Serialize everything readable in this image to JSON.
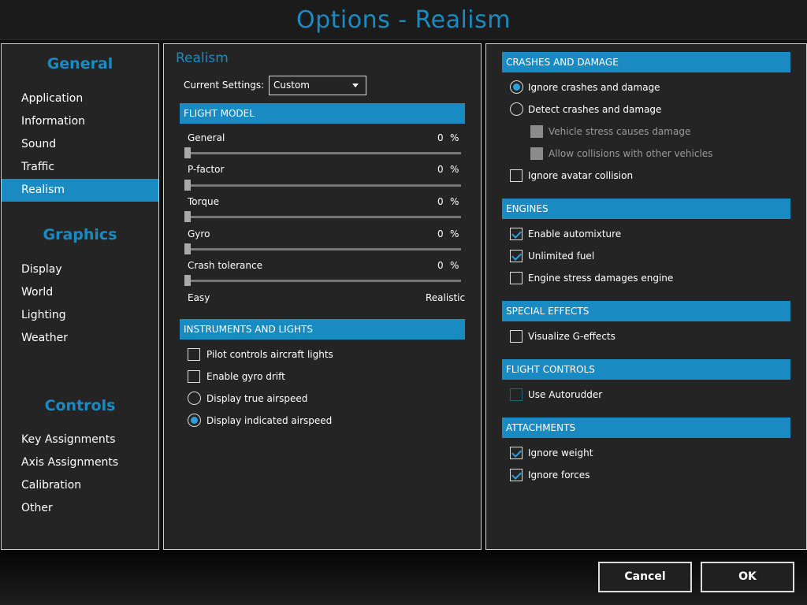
{
  "window": {
    "title": "Options - Realism"
  },
  "sidebar": {
    "groups": [
      {
        "heading": "General",
        "items": [
          "Application",
          "Information",
          "Sound",
          "Traffic",
          "Realism"
        ]
      },
      {
        "heading": "Graphics",
        "items": [
          "Display",
          "World",
          "Lighting",
          "Weather"
        ]
      },
      {
        "heading": "Controls",
        "items": [
          "Key Assignments",
          "Axis Assignments",
          "Calibration",
          "Other"
        ]
      }
    ],
    "selected_item": "Realism"
  },
  "realism": {
    "title": "Realism",
    "current_settings_label": "Current Settings:",
    "current_settings_value": "Custom",
    "flight_model": {
      "header": "FLIGHT MODEL",
      "sliders": [
        {
          "label": "General",
          "value": 0,
          "unit": "%"
        },
        {
          "label": "P-factor",
          "value": 0,
          "unit": "%"
        },
        {
          "label": "Torque",
          "value": 0,
          "unit": "%"
        },
        {
          "label": "Gyro",
          "value": 0,
          "unit": "%"
        },
        {
          "label": "Crash tolerance",
          "value": 0,
          "unit": "%"
        }
      ],
      "scale_min_label": "Easy",
      "scale_max_label": "Realistic"
    },
    "instruments": {
      "header": "INSTRUMENTS AND LIGHTS",
      "pilot_lights": {
        "label": "Pilot controls aircraft lights",
        "checked": false
      },
      "gyro_drift": {
        "label": "Enable gyro drift",
        "checked": false
      },
      "true_airspeed": {
        "label": "Display true airspeed",
        "selected": false
      },
      "indicated_airspeed": {
        "label": "Display indicated airspeed",
        "selected": true
      }
    }
  },
  "crashes": {
    "header": "CRASHES AND DAMAGE",
    "ignore": {
      "label": "Ignore crashes and damage",
      "selected": true
    },
    "detect": {
      "label": "Detect crashes and damage",
      "selected": false
    },
    "vehicle_stress": {
      "label": "Vehicle stress causes damage",
      "checked": false,
      "enabled": false
    },
    "allow_collisions": {
      "label": "Allow collisions with other vehicles",
      "checked": false,
      "enabled": false
    },
    "avatar_collision": {
      "label": "Ignore avatar collision",
      "checked": false
    }
  },
  "engines": {
    "header": "ENGINES",
    "automixture": {
      "label": "Enable automixture",
      "checked": true
    },
    "unlimited_fuel": {
      "label": "Unlimited fuel",
      "checked": true
    },
    "engine_stress": {
      "label": "Engine stress damages engine",
      "checked": false
    }
  },
  "special_effects": {
    "header": "SPECIAL EFFECTS",
    "g_effects": {
      "label": "Visualize G-effects",
      "checked": false
    }
  },
  "flight_controls": {
    "header": "FLIGHT CONTROLS",
    "autorudder": {
      "label": "Use Autorudder",
      "checked": false
    }
  },
  "attachments": {
    "header": "ATTACHMENTS",
    "ignore_weight": {
      "label": "Ignore weight",
      "checked": true
    },
    "ignore_forces": {
      "label": "Ignore forces",
      "checked": true
    }
  },
  "buttons": {
    "cancel": "Cancel",
    "ok": "OK"
  },
  "colors": {
    "accent": "#1a8bc2",
    "panel_bg": "#242424",
    "check_mark": "#2aa0dc"
  }
}
